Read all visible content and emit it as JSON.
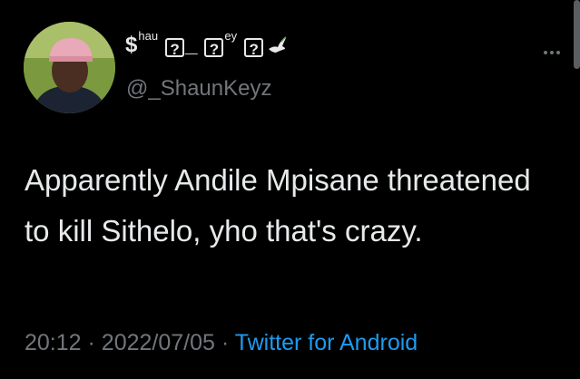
{
  "author": {
    "display_name": "$",
    "sup1": "hau",
    "box_char": "?",
    "sup2": "ey",
    "underscore": "_",
    "handle": "@_ShaunKeyz"
  },
  "tweet": {
    "text": "Apparently Andile Mpisane threatened to kill Sithelo, yho that's crazy.",
    "time": "20:12",
    "separator": "·",
    "date": "2022/07/05",
    "source": "Twitter for Android"
  },
  "colors": {
    "background": "#000000",
    "text": "#e7e9ea",
    "secondary": "#71767b",
    "link": "#1d9bf0"
  },
  "icons": [
    "more-icon",
    "dove-icon"
  ]
}
